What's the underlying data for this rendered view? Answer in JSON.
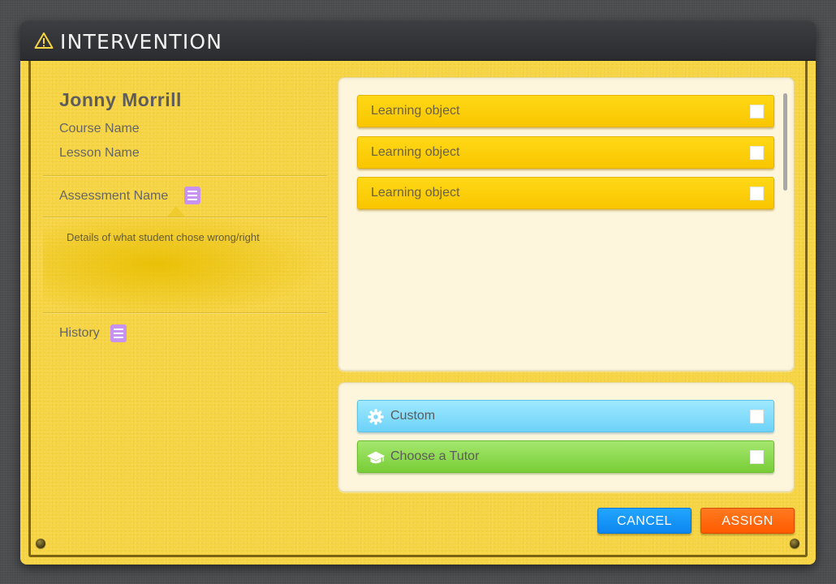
{
  "dialog": {
    "title": "INTERVENTION",
    "title_icon": "warning-triangle-icon"
  },
  "student": {
    "name": "Jonny Morrill",
    "course": "Course Name",
    "lesson": "Lesson Name",
    "assessment": "Assessment Name",
    "details": "Details of what student chose wrong/right",
    "history": "History"
  },
  "learning_objects": [
    {
      "label": "Learning object",
      "checked": false
    },
    {
      "label": "Learning object",
      "checked": false
    },
    {
      "label": "Learning object",
      "checked": false
    }
  ],
  "options": {
    "custom": {
      "label": "Custom",
      "icon": "gear-icon",
      "checked": false
    },
    "tutor": {
      "label": "Choose a Tutor",
      "icon": "graduation-cap-icon",
      "checked": false
    }
  },
  "buttons": {
    "cancel": "CANCEL",
    "assign": "ASSIGN"
  },
  "colors": {
    "body_yellow": "#f6d443",
    "learning_object": "#fdcf0b",
    "custom": "#86ddfb",
    "tutor": "#8fda52",
    "cancel": "#1597f7",
    "assign": "#ff6a10",
    "list_icon": "#c892f0"
  }
}
